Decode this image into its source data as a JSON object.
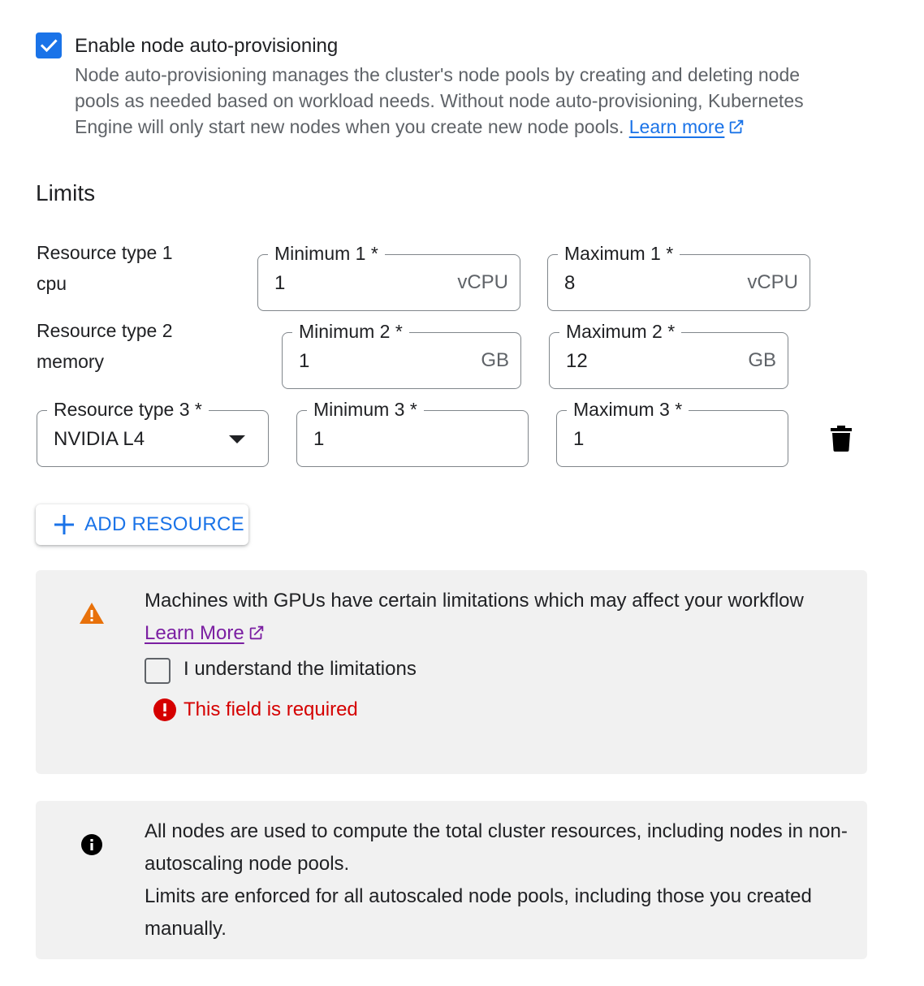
{
  "colors": {
    "primary": "#1a73e8",
    "warning": "#e8710a",
    "error": "#d50000",
    "link_visited": "#7b1fa2",
    "panel_bg": "#f1f1f1"
  },
  "autoprovisioning": {
    "checked": true,
    "label": "Enable node auto-provisioning",
    "description": "Node auto-provisioning manages the cluster's node pools by creating and deleting node pools as needed based on workload needs. Without node auto-provisioning, Kubernetes Engine will only start new nodes when you create new node pools.",
    "learn_more": "Learn more"
  },
  "limits": {
    "title": "Limits",
    "resources": [
      {
        "type_label": "Resource type 1",
        "type_value": "cpu",
        "min_label": "Minimum 1 *",
        "min_value": "1",
        "min_unit": "vCPU",
        "max_label": "Maximum 1 *",
        "max_value": "8",
        "max_unit": "vCPU"
      },
      {
        "type_label": "Resource type 2",
        "type_value": "memory",
        "min_label": "Minimum 2 *",
        "min_value": "1",
        "min_unit": "GB",
        "max_label": "Maximum 2 *",
        "max_value": "12",
        "max_unit": "GB"
      },
      {
        "type_label": "Resource type 3 *",
        "type_value": "NVIDIA L4",
        "min_label": "Minimum 3 *",
        "min_value": "1",
        "max_label": "Maximum 3 *",
        "max_value": "1"
      }
    ],
    "delete_icon": "trash-icon",
    "add_resource": "ADD RESOURCE"
  },
  "gpu_warning": {
    "icon": "warning-icon",
    "text": "Machines with GPUs have certain limitations which may affect your workflow",
    "learn_more": "Learn More",
    "checkbox_checked": false,
    "checkbox_label": "I understand the limitations",
    "error": "This field is required"
  },
  "info": {
    "icon": "info-icon",
    "line1": "All nodes are used to compute the total cluster resources, including nodes in non-autoscaling node pools.",
    "line2": "Limits are enforced for all autoscaled node pools, including those you created manually."
  }
}
